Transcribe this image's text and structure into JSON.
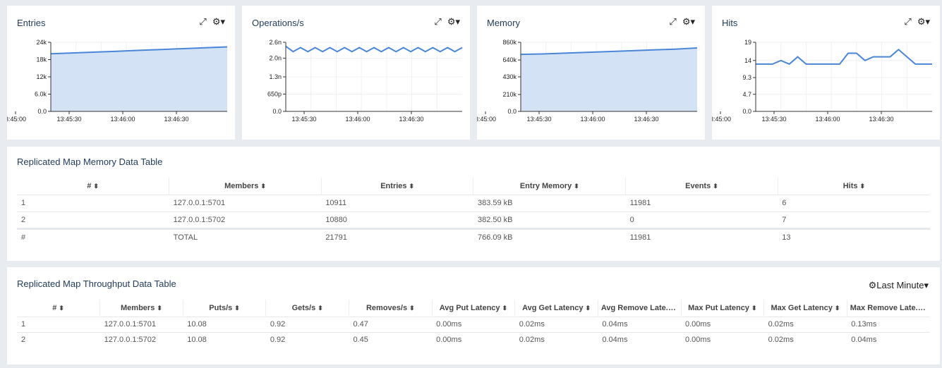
{
  "charts": [
    {
      "title": "Entries",
      "type": "area",
      "yticks": [
        "24k",
        "18k",
        "12k",
        "6.0k",
        "0.0"
      ],
      "yvals": [
        24000,
        18000,
        12000,
        6000,
        0
      ],
      "xticks": [
        "3:45:00",
        "13:45:30",
        "13:46:00",
        "13:46:30"
      ],
      "ymax": 24000,
      "values": [
        20000,
        20300,
        20600,
        20900,
        21200,
        21500,
        21800,
        22100,
        22400
      ]
    },
    {
      "title": "Operations/s",
      "type": "line",
      "yticks": [
        "2.6n",
        "2.0n",
        "1.3n",
        "650p",
        "0.0"
      ],
      "yvals": [
        2.6,
        2.0,
        1.3,
        0.65,
        0
      ],
      "xticks": [
        "13:45:30",
        "13:46:00",
        "13:46:30"
      ],
      "ymax": 2.6,
      "values": [
        2.45,
        2.25,
        2.4,
        2.25,
        2.4,
        2.25,
        2.4,
        2.25,
        2.4,
        2.25,
        2.4,
        2.25,
        2.4,
        2.25,
        2.4,
        2.25,
        2.4,
        2.25,
        2.4,
        2.25,
        2.4,
        2.25,
        2.4,
        2.25,
        2.4
      ]
    },
    {
      "title": "Memory",
      "type": "area",
      "yticks": [
        "860k",
        "640k",
        "430k",
        "210k",
        "0.0"
      ],
      "yvals": [
        860000,
        640000,
        430000,
        210000,
        0
      ],
      "xticks": [
        "3:45:00",
        "13:45:30",
        "13:46:00",
        "13:46:30"
      ],
      "ymax": 860000,
      "values": [
        710000,
        715000,
        725000,
        735000,
        745000,
        755000,
        765000,
        775000,
        790000
      ]
    },
    {
      "title": "Hits",
      "type": "line",
      "yticks": [
        "19",
        "14",
        "9.3",
        "4.7",
        "0.0"
      ],
      "yvals": [
        19,
        14,
        9.3,
        4.7,
        0
      ],
      "xticks": [
        "3:45:00",
        "13:45:30",
        "13:46:00",
        "13:46:30"
      ],
      "ymax": 19,
      "values": [
        13,
        13,
        13,
        14,
        13,
        15,
        13,
        13,
        13,
        13,
        13,
        16,
        16,
        14,
        15,
        15,
        15,
        17,
        15,
        13,
        13,
        13
      ]
    }
  ],
  "memory_table": {
    "title": "Replicated Map Memory Data Table",
    "headers": [
      "#",
      "Members",
      "Entries",
      "Entry Memory",
      "Events",
      "Hits"
    ],
    "rows": [
      [
        "1",
        "127.0.0.1:5701",
        "10911",
        "383.59 kB",
        "11981",
        "6"
      ],
      [
        "2",
        "127.0.0.1:5702",
        "10880",
        "382.50 kB",
        "0",
        "7"
      ]
    ],
    "total": [
      "#",
      "TOTAL",
      "21791",
      "766.09 kB",
      "11981",
      "13"
    ]
  },
  "throughput_table": {
    "title": "Replicated Map Throughput Data Table",
    "range_label": "Last Minute",
    "headers": [
      "#",
      "Members",
      "Puts/s",
      "Gets/s",
      "Removes/s",
      "Avg Put Latency",
      "Avg Get Latency",
      "Avg Remove Late...",
      "Max Put Latency",
      "Max Get Latency",
      "Max Remove Late..."
    ],
    "rows": [
      [
        "1",
        "127.0.0.1:5701",
        "10.08",
        "0.92",
        "0.47",
        "0.00ms",
        "0.02ms",
        "0.04ms",
        "0.00ms",
        "0.02ms",
        "0.13ms"
      ],
      [
        "2",
        "127.0.0.1:5702",
        "10.08",
        "0.92",
        "0.45",
        "0.00ms",
        "0.02ms",
        "0.04ms",
        "0.00ms",
        "0.02ms",
        "0.04ms"
      ]
    ]
  },
  "colors": {
    "line": "#4a86d8",
    "fill": "#d4e2f5",
    "title": "#1f3a5a"
  }
}
